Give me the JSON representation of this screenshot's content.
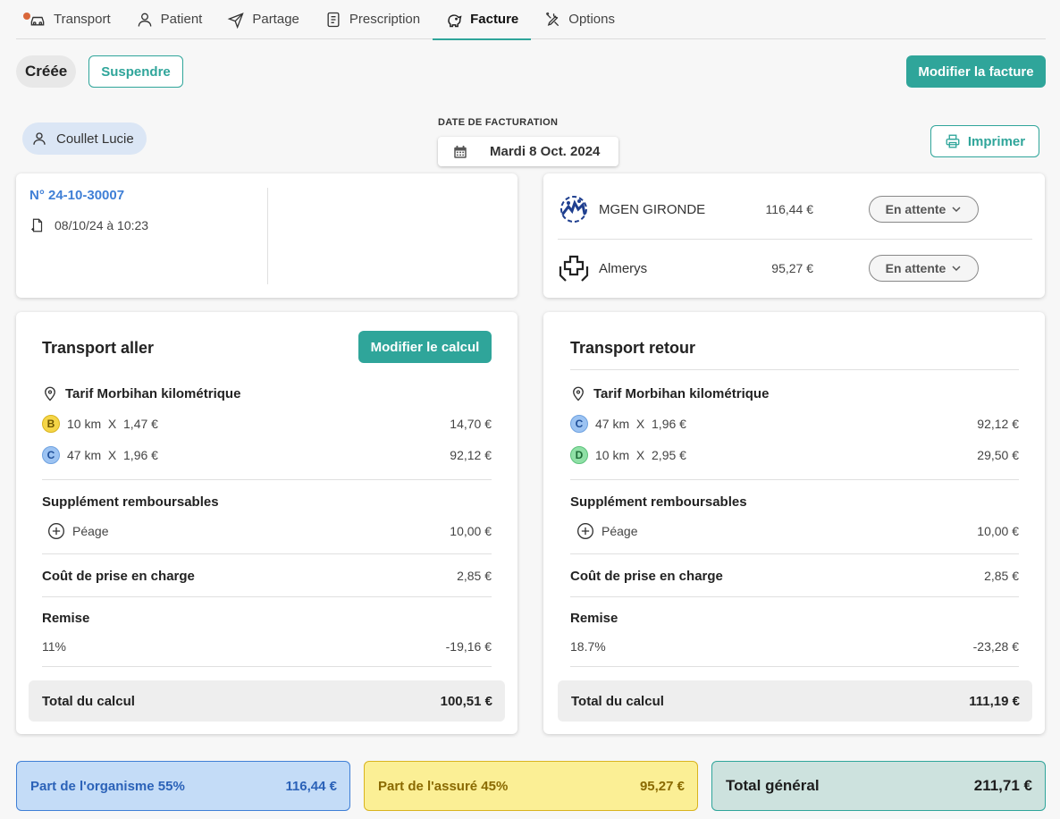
{
  "tabs": [
    {
      "label": "Transport",
      "icon": "car-icon"
    },
    {
      "label": "Patient",
      "icon": "person-icon"
    },
    {
      "label": "Partage",
      "icon": "send-icon"
    },
    {
      "label": "Prescription",
      "icon": "document-icon"
    },
    {
      "label": "Facture",
      "icon": "piggy-bank-icon"
    },
    {
      "label": "Options",
      "icon": "tools-icon"
    }
  ],
  "active_tab": "Facture",
  "status": "Créée",
  "actions": {
    "suspend": "Suspendre",
    "edit_invoice": "Modifier la facture",
    "print": "Imprimer"
  },
  "patient": {
    "name": "Coullet Lucie"
  },
  "billing_date": {
    "label": "DATE DE FACTURATION",
    "value": "Mardi 8 Oct. 2024"
  },
  "invoice": {
    "number": "N° 24-10-30007",
    "created": "08/10/24 à 10:23"
  },
  "insurers": [
    {
      "name": "MGEN GIRONDE",
      "amount": "116,44 €",
      "status": "En attente"
    },
    {
      "name": "Almerys",
      "amount": "95,27 €",
      "status": "En attente"
    }
  ],
  "transport_aller": {
    "title": "Transport aller",
    "edit_button": "Modifier le calcul",
    "tarif": "Tarif Morbihan kilométrique",
    "lines": [
      {
        "badge": "B",
        "desc": "10 km  X  1,47 €",
        "amount": "14,70 €"
      },
      {
        "badge": "C",
        "desc": "47 km  X  1,96 €",
        "amount": "92,12 €"
      }
    ],
    "supplements_label": "Supplément remboursables",
    "supplement": {
      "label": "Péage",
      "amount": "10,00 €"
    },
    "prise_en_charge": {
      "label": "Coût de prise en charge",
      "amount": "2,85 €"
    },
    "remise": {
      "label": "Remise",
      "rate": "11%",
      "amount": "-19,16 €"
    },
    "total": {
      "label": "Total du calcul",
      "amount": "100,51 €"
    }
  },
  "transport_retour": {
    "title": "Transport retour",
    "tarif": "Tarif Morbihan kilométrique",
    "lines": [
      {
        "badge": "C",
        "desc": "47 km  X  1,96 €",
        "amount": "92,12 €"
      },
      {
        "badge": "D",
        "desc": "10 km  X  2,95 €",
        "amount": "29,50 €"
      }
    ],
    "supplements_label": "Supplément remboursables",
    "supplement": {
      "label": "Péage",
      "amount": "10,00 €"
    },
    "prise_en_charge": {
      "label": "Coût de prise en charge",
      "amount": "2,85 €"
    },
    "remise": {
      "label": "Remise",
      "rate": "18.7%",
      "amount": "-23,28 €"
    },
    "total": {
      "label": "Total du calcul",
      "amount": "111,19 €"
    }
  },
  "summary": {
    "organisme": {
      "label": "Part de l'organisme 55%",
      "amount": "116,44 €"
    },
    "assure": {
      "label": "Part de l'assuré 45%",
      "amount": "95,27 €"
    },
    "general": {
      "label": "Total général",
      "amount": "211,71 €"
    }
  },
  "colors": {
    "accent": "#2fa59a",
    "badge_B": "#f5d547",
    "badge_C": "#9cc3f2",
    "badge_D": "#8fe0a6",
    "organisme_bg": "#c4dcf7",
    "assure_bg": "#fbef95",
    "general_bg": "#cde2de"
  }
}
